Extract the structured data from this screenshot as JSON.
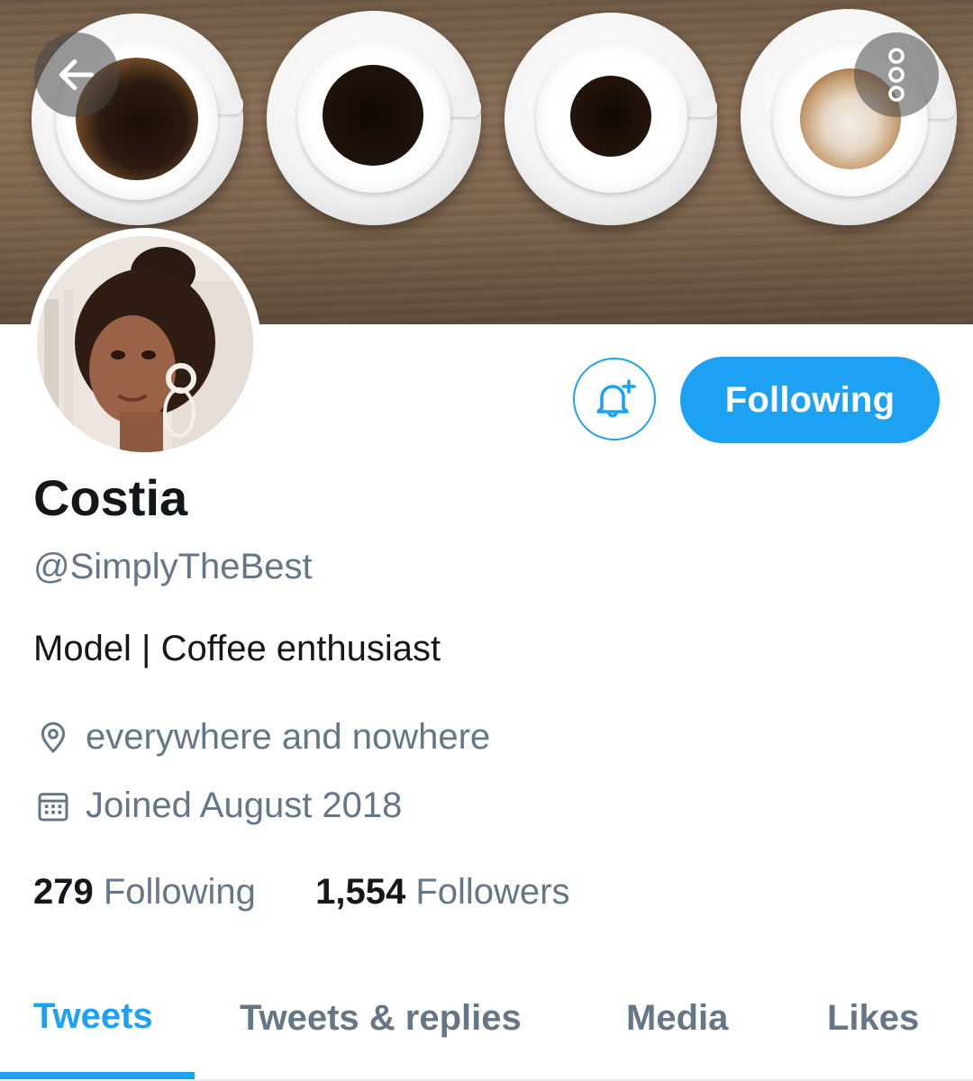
{
  "profile": {
    "name": "Costia",
    "handle": "@SimplyTheBest",
    "bio": "Model | Coffee enthusiast",
    "location": "everywhere and nowhere",
    "joined": "Joined August 2018"
  },
  "actions": {
    "follow_label": "Following"
  },
  "stats": {
    "following_count": "279",
    "following_label": "Following",
    "followers_count": "1,554",
    "followers_label": "Followers"
  },
  "tabs": [
    {
      "label": "Tweets",
      "active": true
    },
    {
      "label": "Tweets & replies",
      "active": false
    },
    {
      "label": "Media",
      "active": false
    },
    {
      "label": "Likes",
      "active": false
    }
  ],
  "colors": {
    "accent": "#1da1f2",
    "primary_text": "#14171a",
    "secondary_text": "#657786"
  },
  "icons": {
    "back": "arrow-left-icon",
    "more": "more-vertical-icon",
    "notify": "bell-plus-icon",
    "location": "location-pin-icon",
    "calendar": "calendar-icon"
  }
}
